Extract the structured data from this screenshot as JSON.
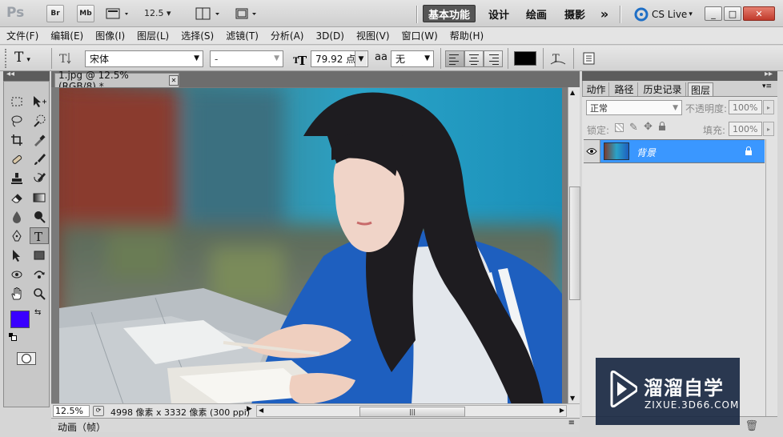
{
  "appbar": {
    "logo": "Ps",
    "bridge_label": "Br",
    "minibridge_label": "Mb",
    "zoom_value": "12.5",
    "workspaces": [
      "基本功能",
      "设计",
      "绘画",
      "摄影"
    ],
    "more_label": "»",
    "cs_live": "CS Live",
    "window_buttons": [
      "_",
      "□",
      "✕"
    ]
  },
  "menubar": {
    "items": [
      "文件(F)",
      "编辑(E)",
      "图像(I)",
      "图层(L)",
      "选择(S)",
      "滤镜(T)",
      "分析(A)",
      "3D(D)",
      "视图(V)",
      "窗口(W)",
      "帮助(H)"
    ]
  },
  "options": {
    "tool_label": "T",
    "font_family": "宋体",
    "font_style": "-",
    "font_size": "79.92 点",
    "aa_label": "aa",
    "antialias": "无",
    "color": "#000000"
  },
  "document": {
    "tab_title": "1.jpg @ 12.5%(RGB/8) *",
    "close_label": "✕",
    "zoom": "12.5%",
    "doc_info": "4998 像素 x 3332 像素 (300 ppi)",
    "anim_label": "动画（帧）"
  },
  "tools": {
    "foreground": "#3a00ff",
    "background": "#000000"
  },
  "panel": {
    "tabs": [
      "动作",
      "路径",
      "历史记录",
      "图层"
    ],
    "blend_mode": "正常",
    "opacity_label": "不透明度:",
    "opacity_value": "100%",
    "lock_label": "锁定:",
    "fill_label": "填充:",
    "fill_value": "100%",
    "layer_name": "背景"
  },
  "watermark": {
    "title": "溜溜自学",
    "url": "ZIXUE.3D66.COM"
  }
}
